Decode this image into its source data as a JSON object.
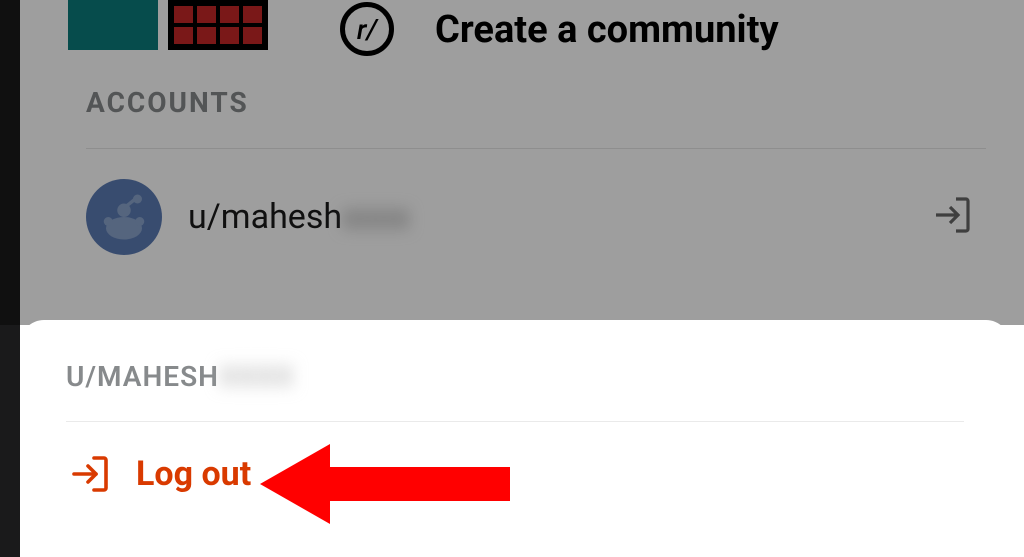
{
  "background": {
    "create_community_label": "Create a community",
    "community_icon_text": "r/",
    "accounts_heading": "ACCOUNTS",
    "account_username_prefix": "u/mahesh",
    "account_username_blurred": "xxxx"
  },
  "sheet": {
    "title_prefix": "U/MAHESH",
    "title_blurred": "XXXX",
    "logout_label": "Log out"
  },
  "colors": {
    "accent_red": "#d93a00",
    "muted_gray": "#878a8c",
    "avatar_blue": "#5b7bb4"
  }
}
